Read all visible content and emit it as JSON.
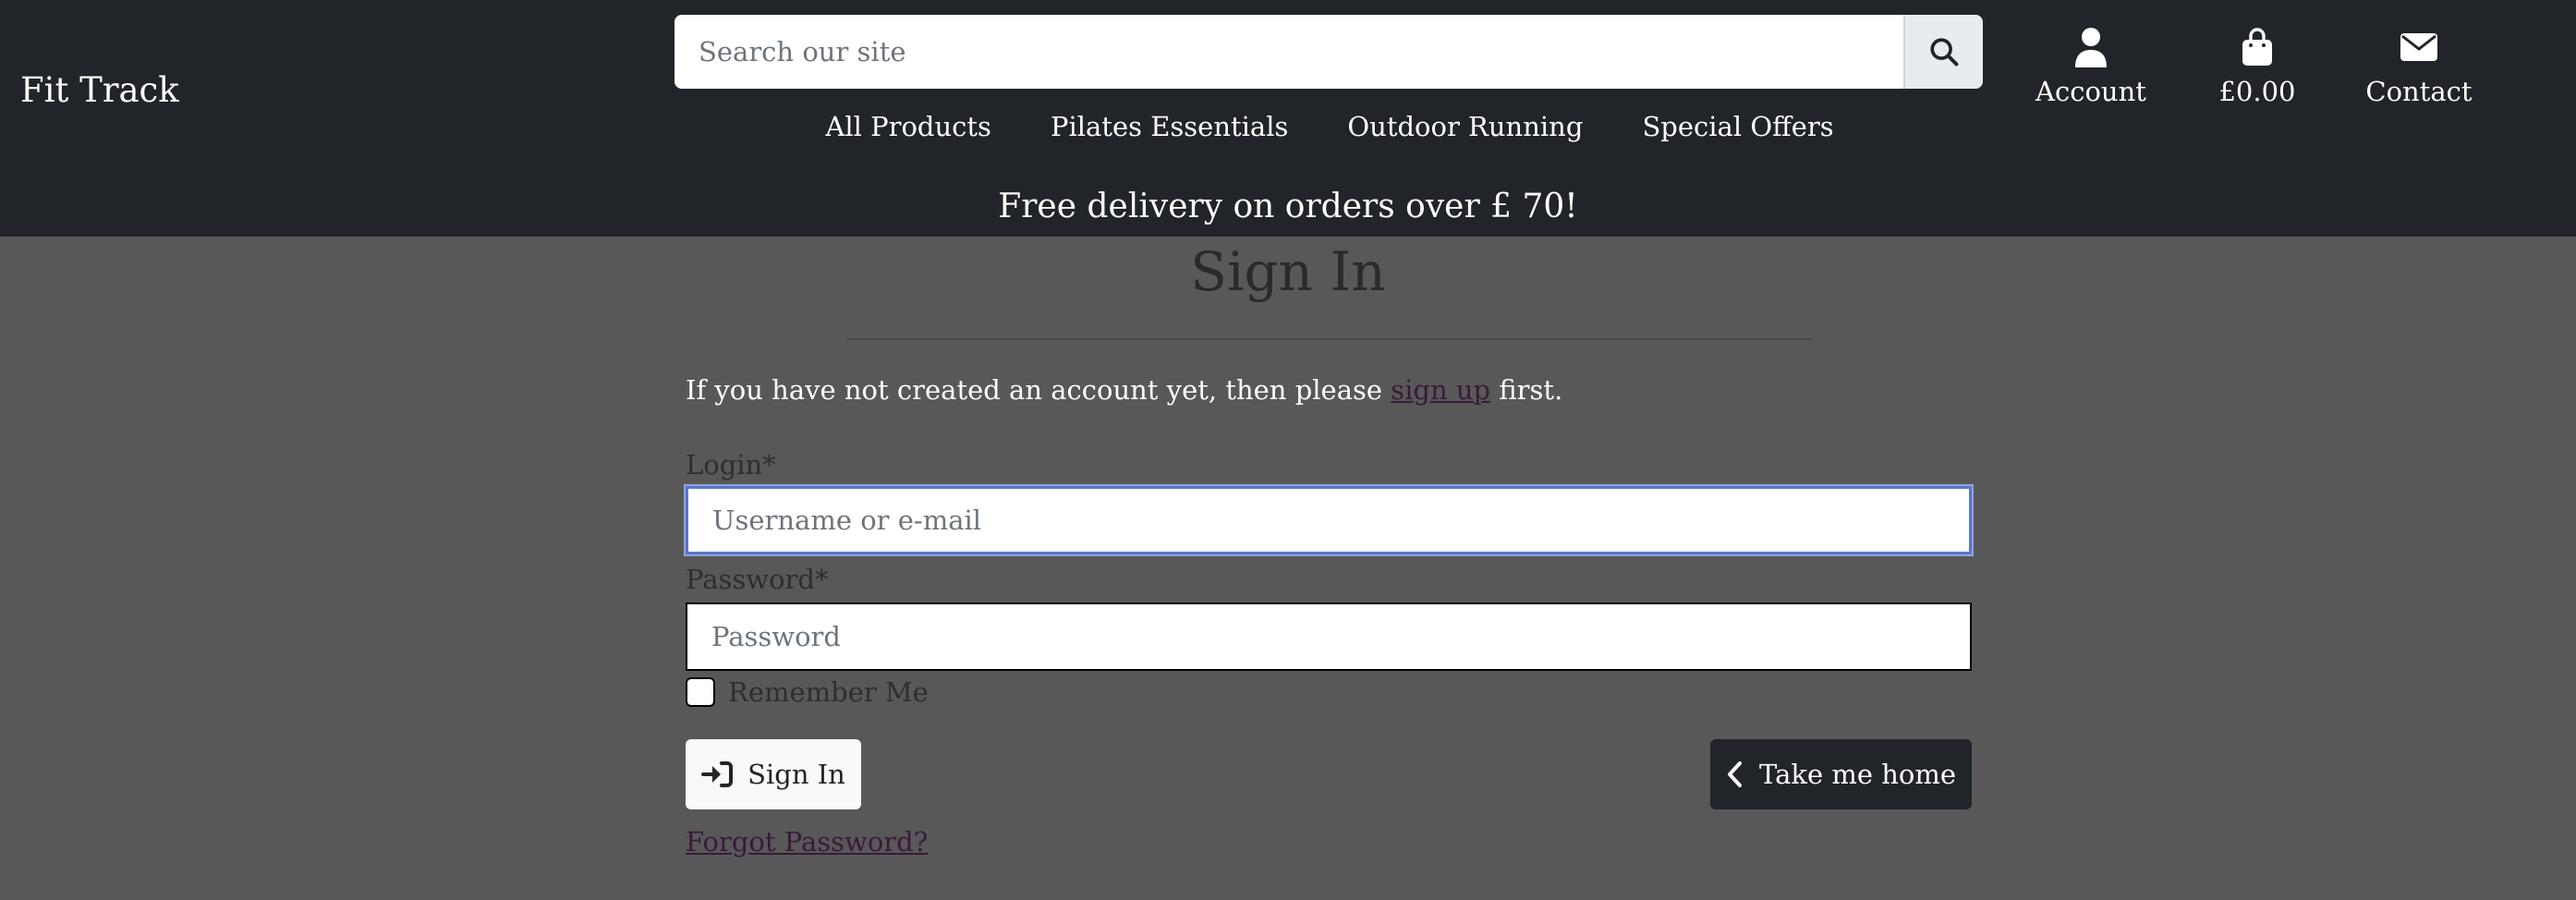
{
  "header": {
    "logo": "Fit Track",
    "search": {
      "placeholder": "Search our site",
      "icon": "search-icon"
    },
    "top_links": [
      {
        "label": "Account",
        "icon": "user-icon"
      },
      {
        "label": "£0.00",
        "icon": "shopping-bag-icon"
      },
      {
        "label": "Contact",
        "icon": "envelope-icon"
      }
    ],
    "nav": [
      "All Products",
      "Pilates Essentials",
      "Outdoor Running",
      "Special Offers"
    ],
    "banner": "Free delivery on orders over £ 70!"
  },
  "main": {
    "title": "Sign In",
    "intro": {
      "before": "If you have not created an account yet, then please ",
      "link": "sign up",
      "after": " first."
    },
    "login": {
      "label": "Login*",
      "placeholder": "Username or e-mail",
      "value": ""
    },
    "password": {
      "label": "Password*",
      "placeholder": "Password",
      "value": ""
    },
    "remember": {
      "label": "Remember Me",
      "checked": false
    },
    "signin_button": {
      "label": "Sign In",
      "icon": "sign-in-icon"
    },
    "home_button": {
      "label": "Take me home",
      "icon": "chevron-left-icon"
    },
    "forgot_link": "Forgot Password?"
  },
  "colors": {
    "header_bg": "#212529",
    "page_bg": "#585858",
    "link": "#3a1a3a",
    "focus": "#5a76c8"
  }
}
